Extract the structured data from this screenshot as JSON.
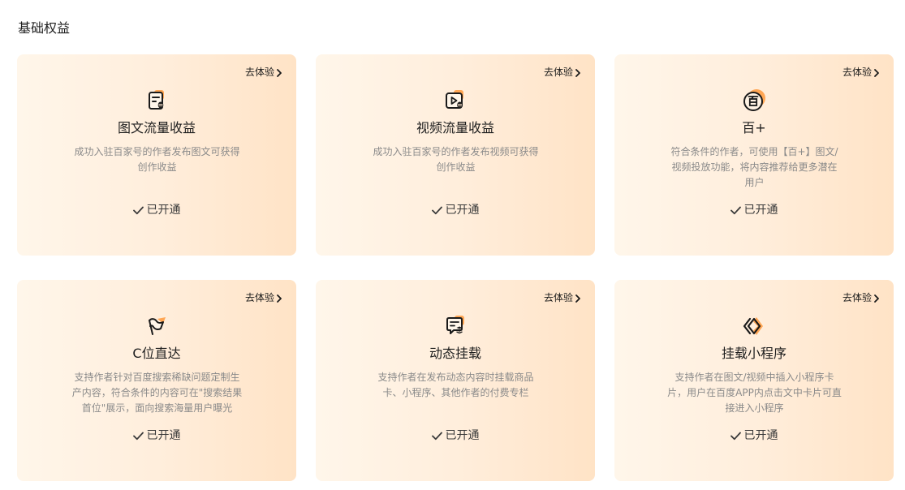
{
  "section": {
    "title": "基础权益"
  },
  "colors": {
    "accent": "#ffa654",
    "card_gradient_start": "#fff6ea",
    "card_gradient_end": "#ffe3c6",
    "icon_stroke": "#1a1a1a"
  },
  "cards": [
    {
      "title": "图文流量收益",
      "description": "成功入驻百家号的作者发布图文可获得创作收益",
      "status": "已开通",
      "link": "去体验",
      "icon": "article-revenue-icon"
    },
    {
      "title": "视频流量收益",
      "description": "成功入驻百家号的作者发布视频可获得创作收益",
      "status": "已开通",
      "link": "去体验",
      "icon": "video-revenue-icon"
    },
    {
      "title": "百+",
      "description": "符合条件的作者，可使用【百+】图文/视频投放功能，将内容推荐给更多潜在用户",
      "status": "已开通",
      "link": "去体验",
      "icon": "bai-plus-icon"
    },
    {
      "title": "C位直达",
      "description": "支持作者针对百度搜索稀缺问题定制生产内容，符合条件的内容可在\"搜索结果首位\"展示，面向搜索海量用户曝光",
      "status": "已开通",
      "link": "去体验",
      "icon": "flag-icon"
    },
    {
      "title": "动态挂载",
      "description": "支持作者在发布动态内容时挂载商品卡、小程序、其他作者的付费专栏",
      "status": "已开通",
      "link": "去体验",
      "icon": "dynamic-mount-icon"
    },
    {
      "title": "挂载小程序",
      "description": "支持作者在图文/视频中插入小程序卡片，用户在百度APP内点击文中卡片可直接进入小程序",
      "status": "已开通",
      "link": "去体验",
      "icon": "mini-program-icon"
    }
  ]
}
